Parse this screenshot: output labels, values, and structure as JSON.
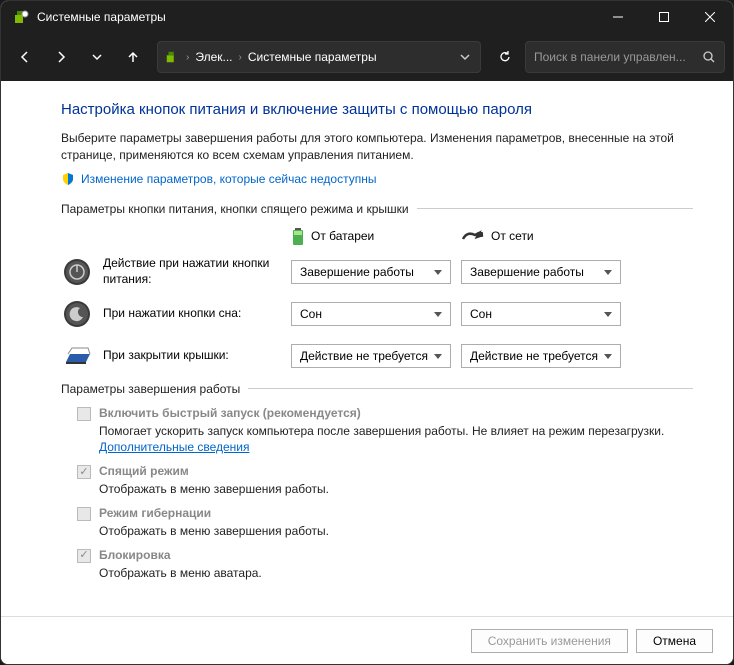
{
  "titlebar": {
    "title": "Системные параметры"
  },
  "breadcrumb": {
    "seg1": "Элек...",
    "seg2": "Системные параметры"
  },
  "search": {
    "placeholder": "Поиск в панели управлен..."
  },
  "heading": "Настройка кнопок питания и включение защиты с помощью пароля",
  "intro": "Выберите параметры завершения работы для этого компьютера. Изменения параметров, внесенные на этой странице, применяются ко всем схемам управления питанием.",
  "change_link": "Изменение параметров, которые сейчас недоступны",
  "group1_header": "Параметры кнопки питания, кнопки спящего режима и крышки",
  "col_battery": "От батареи",
  "col_plugged": "От сети",
  "rows": {
    "power": {
      "label": "Действие при нажатии кнопки питания:",
      "battery": "Завершение работы",
      "plugged": "Завершение работы"
    },
    "sleep": {
      "label": "При нажатии кнопки сна:",
      "battery": "Сон",
      "plugged": "Сон"
    },
    "lid": {
      "label": "При закрытии крышки:",
      "battery": "Действие не требуется",
      "plugged": "Действие не требуется"
    }
  },
  "group2_header": "Параметры завершения работы",
  "checks": {
    "fast": {
      "label": "Включить быстрый запуск (рекомендуется)",
      "desc": "Помогает ускорить запуск компьютера после завершения работы. Не влияет на режим перезагрузки. ",
      "link": "Дополнительные сведения"
    },
    "sleep": {
      "label": "Спящий режим",
      "desc": "Отображать в меню завершения работы."
    },
    "hiber": {
      "label": "Режим гибернации",
      "desc": "Отображать в меню завершения работы."
    },
    "lock": {
      "label": "Блокировка",
      "desc": "Отображать в меню аватара."
    }
  },
  "footer": {
    "save": "Сохранить изменения",
    "cancel": "Отмена"
  }
}
